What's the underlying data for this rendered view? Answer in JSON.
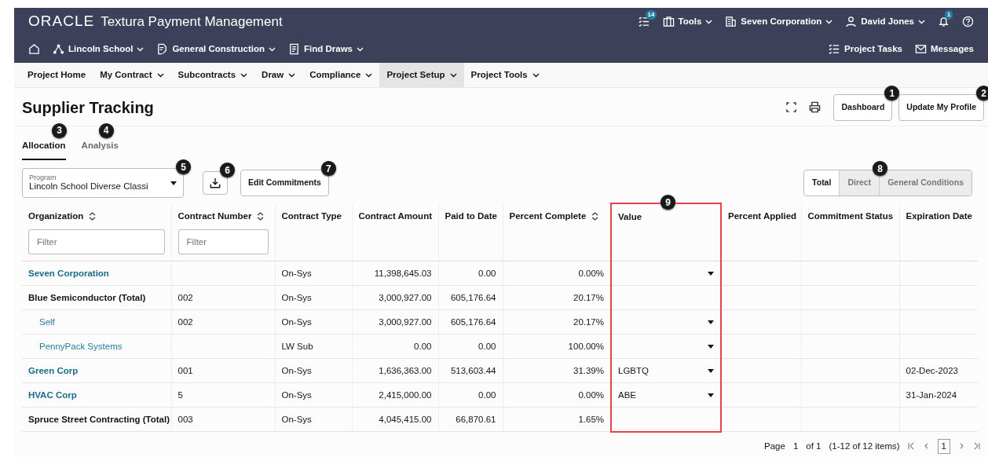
{
  "header": {
    "logo": "ORACLE",
    "app_title": "Textura Payment Management",
    "top_items": [
      {
        "kind": "tasks",
        "badge": "14"
      },
      {
        "kind": "tools",
        "label": "Tools",
        "has_menu": true
      },
      {
        "kind": "company",
        "label": "Seven Corporation",
        "has_menu": true
      },
      {
        "kind": "user",
        "label": "David Jones",
        "has_menu": true
      },
      {
        "kind": "bell",
        "badge": "1"
      },
      {
        "kind": "help"
      }
    ],
    "context_items": [
      {
        "kind": "home"
      },
      {
        "kind": "project",
        "label": "Lincoln School",
        "has_menu": true
      },
      {
        "kind": "contract",
        "label": "General Construction",
        "has_menu": true
      },
      {
        "kind": "draws",
        "label": "Find Draws",
        "has_menu": true
      }
    ],
    "right_links": [
      {
        "kind": "tasks",
        "label": "Project Tasks"
      },
      {
        "kind": "mail",
        "label": "Messages"
      }
    ]
  },
  "menu": [
    {
      "label": "Project Home",
      "has_menu": false,
      "selected": false
    },
    {
      "label": "My Contract",
      "has_menu": true,
      "selected": false
    },
    {
      "label": "Subcontracts",
      "has_menu": true,
      "selected": false
    },
    {
      "label": "Draw",
      "has_menu": true,
      "selected": false
    },
    {
      "label": "Compliance",
      "has_menu": true,
      "selected": false
    },
    {
      "label": "Project Setup",
      "has_menu": true,
      "selected": true
    },
    {
      "label": "Project Tools",
      "has_menu": true,
      "selected": false
    }
  ],
  "page": {
    "title": "Supplier Tracking",
    "buttons": [
      {
        "label": "Dashboard",
        "callout": "1"
      },
      {
        "label": "Update My Profile",
        "callout": "2"
      }
    ],
    "tabs": [
      {
        "label": "Allocation",
        "selected": true,
        "callout": "3"
      },
      {
        "label": "Analysis",
        "selected": false,
        "callout": "4"
      }
    ],
    "program": {
      "label": "Program",
      "value": "Lincoln School Diverse Classi",
      "callout": "5"
    },
    "download_callout": "6",
    "edit_button": {
      "label": "Edit Commitments",
      "callout": "7"
    },
    "segments": {
      "callout": "8",
      "items": [
        {
          "label": "Total",
          "selected": true
        },
        {
          "label": "Direct",
          "selected": false
        },
        {
          "label": "General Conditions",
          "selected": false
        }
      ]
    }
  },
  "table": {
    "columns": [
      {
        "label": "Organization",
        "sortable": true,
        "placeholder": "Filter",
        "highlighted": false
      },
      {
        "label": "Contract Number",
        "sortable": true,
        "placeholder": "Filter",
        "highlighted": false
      },
      {
        "label": "Contract Type",
        "sortable": false,
        "highlighted": false
      },
      {
        "label": "Contract Amount",
        "sortable": false,
        "highlighted": false
      },
      {
        "label": "Paid to Date",
        "sortable": false,
        "highlighted": false
      },
      {
        "label": "Percent Complete",
        "sortable": true,
        "highlighted": false
      },
      {
        "label": "Value",
        "sortable": false,
        "highlighted": true,
        "callout": "9"
      },
      {
        "label": "Percent Applied",
        "sortable": false,
        "highlighted": false
      },
      {
        "label": "Commitment Status",
        "sortable": false,
        "highlighted": false
      },
      {
        "label": "Expiration Date",
        "sortable": false,
        "highlighted": false
      }
    ],
    "rows": [
      {
        "kind": "company",
        "organization": "Seven Corporation",
        "contract_number": "",
        "contract_type": "On-Sys",
        "contract_amount": "11,398,645.03",
        "paid_to_date": "0.00",
        "percent_complete": "0.00%",
        "value": "",
        "value_dropdown": true,
        "expiration_date": ""
      },
      {
        "kind": "total",
        "organization": "Blue Semiconductor (Total)",
        "contract_number": "002",
        "contract_type": "On-Sys",
        "contract_amount": "3,000,927.00",
        "paid_to_date": "605,176.64",
        "percent_complete": "20.17%",
        "value": "",
        "value_dropdown": false,
        "expiration_date": ""
      },
      {
        "kind": "child",
        "organization": "Self",
        "contract_number": "002",
        "contract_type": "On-Sys",
        "contract_amount": "3,000,927.00",
        "paid_to_date": "605,176.64",
        "percent_complete": "20.17%",
        "value": "",
        "value_dropdown": true,
        "expiration_date": ""
      },
      {
        "kind": "child",
        "organization": "PennyPack Systems",
        "contract_number": "",
        "contract_type": "LW Sub",
        "contract_amount": "0.00",
        "paid_to_date": "0.00",
        "percent_complete": "100.00%",
        "value": "",
        "value_dropdown": true,
        "expiration_date": ""
      },
      {
        "kind": "company",
        "organization": "Green Corp",
        "contract_number": "001",
        "contract_type": "On-Sys",
        "contract_amount": "1,636,363.00",
        "paid_to_date": "513,603.44",
        "percent_complete": "31.39%",
        "value": "LGBTQ",
        "value_dropdown": true,
        "expiration_date": "02-Dec-2023"
      },
      {
        "kind": "company",
        "organization": "HVAC Corp",
        "contract_number": "5",
        "contract_type": "On-Sys",
        "contract_amount": "2,415,000.00",
        "paid_to_date": "0.00",
        "percent_complete": "0.00%",
        "value": "ABE",
        "value_dropdown": true,
        "expiration_date": "31-Jan-2024"
      },
      {
        "kind": "total",
        "organization": "Spruce Street Contracting (Total)",
        "contract_number": "003",
        "contract_type": "On-Sys",
        "contract_amount": "4,045,415.00",
        "paid_to_date": "66,870.61",
        "percent_complete": "1.65%",
        "value": "",
        "value_dropdown": false,
        "expiration_date": ""
      }
    ]
  },
  "pagination": {
    "label": "Page",
    "page": "1",
    "of": "of 1",
    "summary": "(1-12 of 12 items)",
    "current": "1"
  }
}
